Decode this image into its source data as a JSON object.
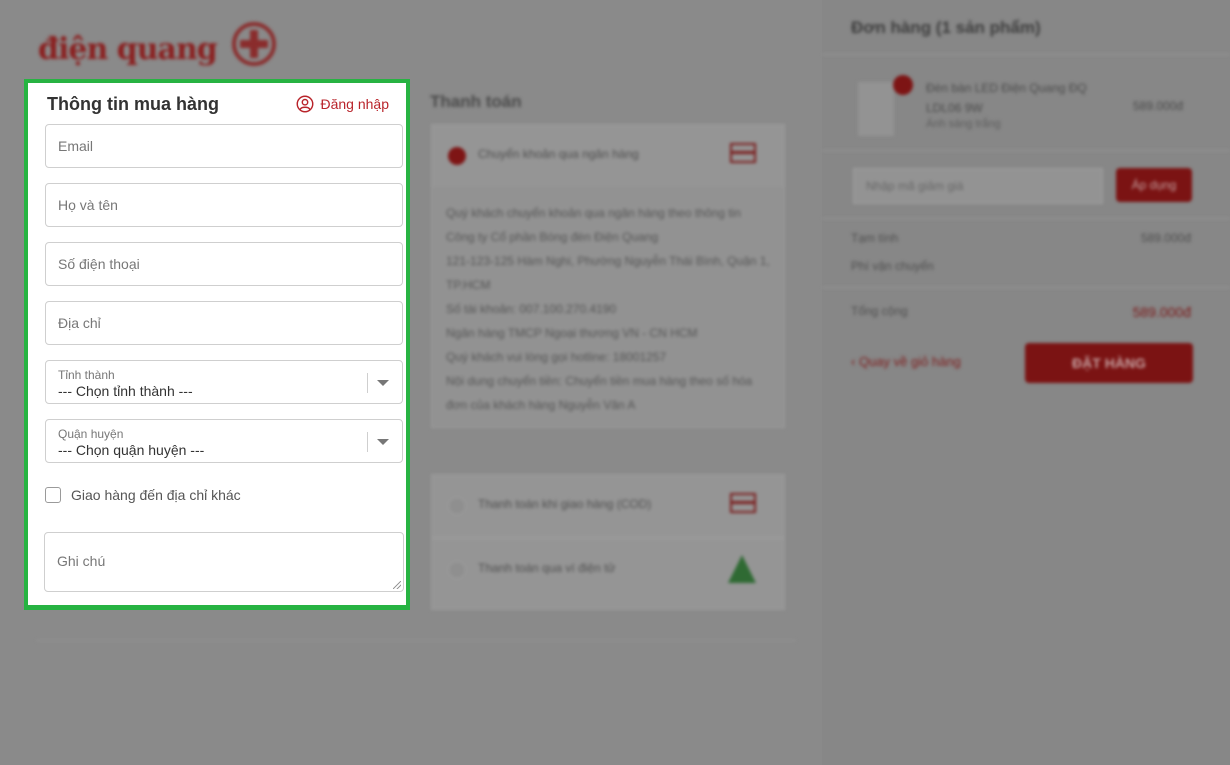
{
  "brand": {
    "logo_text": "điện quang"
  },
  "form": {
    "title": "Thông tin mua hàng",
    "login_label": "Đăng nhập",
    "email_placeholder": "Email",
    "name_placeholder": "Họ và tên",
    "phone_placeholder": "Số điện thoại",
    "address_placeholder": "Địa chỉ",
    "province": {
      "label": "Tỉnh thành",
      "value": "--- Chọn tỉnh thành ---"
    },
    "district": {
      "label": "Quận huyện",
      "value": "--- Chọn quận huyện ---"
    },
    "ship_other_label": "Giao hàng đến địa chỉ khác",
    "ship_other_checked": false,
    "note_placeholder": "Ghi chú"
  },
  "payment": {
    "title": "Thanh toán",
    "options": [
      {
        "label": "Chuyển khoản qua ngân hàng",
        "selected": true,
        "icon": "card-icon"
      },
      {
        "label": "Thanh toán khi giao hàng (COD)",
        "selected": false,
        "icon": "card-icon"
      },
      {
        "label": "Thanh toán qua ví điện tử",
        "selected": false,
        "icon": "wallet-icon"
      }
    ],
    "bank_details": [
      "Quý khách chuyển khoản qua ngân hàng theo thông tin",
      "Công ty Cổ phần Bóng đèn Điện Quang",
      "121-123-125 Hàm Nghi, Phường Nguyễn Thái Bình, Quận 1, TP.HCM",
      "Số tài khoản: 007.100.270.4190",
      "Ngân hàng TMCP Ngoại thương VN - CN HCM",
      "Quý khách vui lòng gọi hotline: 18001257",
      "Nội dung chuyển tiền: Chuyển tiền mua hàng theo số hóa đơn của khách hàng Nguyễn Văn A"
    ]
  },
  "order": {
    "title": "Đơn hàng (1 sản phẩm)",
    "product": {
      "name": "Đèn bàn LED Điện Quang ĐQ LDL06 9W",
      "variant": "Ánh sáng trắng",
      "price": "589.000đ"
    },
    "coupon_placeholder": "Nhập mã giảm giá",
    "coupon_button": "Áp dụng",
    "subtotal_label": "Tạm tính",
    "subtotal_value": "589.000đ",
    "shipping_label": "Phí vận chuyển",
    "shipping_value": "",
    "total_label": "Tổng cộng",
    "total_value": "589.000đ",
    "back_link": "‹ Quay về giỏ hàng",
    "order_button": "ĐẶT HÀNG"
  }
}
